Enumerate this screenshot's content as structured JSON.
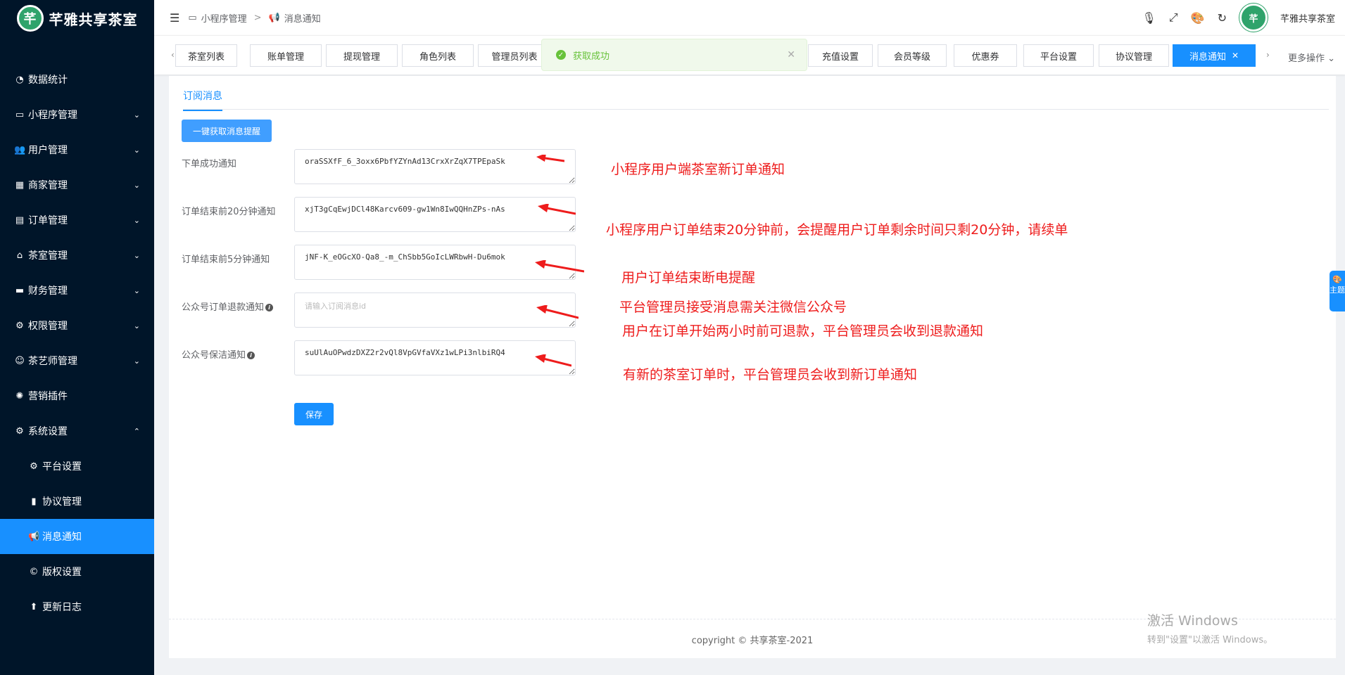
{
  "app": {
    "logo_text": "芊雅共享茶室",
    "logo_mark": "芊"
  },
  "sidebar": {
    "items": [
      {
        "label": "数据统计",
        "icon": "dashboard-icon",
        "glyph": "◔",
        "arrow": ""
      },
      {
        "label": "小程序管理",
        "icon": "laptop-icon",
        "glyph": "▭",
        "arrow": "⌄"
      },
      {
        "label": "用户管理",
        "icon": "users-icon",
        "glyph": "👥",
        "arrow": "⌄"
      },
      {
        "label": "商家管理",
        "icon": "store-icon",
        "glyph": "▦",
        "arrow": "⌄"
      },
      {
        "label": "订单管理",
        "icon": "clipboard-icon",
        "glyph": "▤",
        "arrow": "⌄"
      },
      {
        "label": "茶室管理",
        "icon": "home-icon",
        "glyph": "⌂",
        "arrow": "⌄"
      },
      {
        "label": "财务管理",
        "icon": "finance-icon",
        "glyph": "▬",
        "arrow": "⌄"
      },
      {
        "label": "权限管理",
        "icon": "permission-icon",
        "glyph": "⚙",
        "arrow": "⌄"
      },
      {
        "label": "茶艺师管理",
        "icon": "user-cog-icon",
        "glyph": "☺",
        "arrow": "⌄"
      },
      {
        "label": "营销插件",
        "icon": "plugin-icon",
        "glyph": "✺",
        "arrow": ""
      },
      {
        "label": "系统设置",
        "icon": "gear-icon",
        "glyph": "⚙",
        "arrow": "⌃"
      }
    ],
    "sub_items": [
      {
        "label": "平台设置",
        "icon": "gear-icon",
        "glyph": "⚙"
      },
      {
        "label": "协议管理",
        "icon": "book-icon",
        "glyph": "▮"
      },
      {
        "label": "消息通知",
        "icon": "megaphone-icon",
        "glyph": "📢"
      },
      {
        "label": "版权设置",
        "icon": "copyright-icon",
        "glyph": "©"
      },
      {
        "label": "更新日志",
        "icon": "upload-icon",
        "glyph": "⬆"
      }
    ]
  },
  "header": {
    "breadcrumb": [
      "小程序管理",
      "消息通知"
    ],
    "username": "芊雅共享茶室",
    "avatar_mark": "芊"
  },
  "tabs": [
    {
      "label": "茶室列表"
    },
    {
      "label": "账单管理"
    },
    {
      "label": "提现管理"
    },
    {
      "label": "角色列表"
    },
    {
      "label": "管理员列表"
    },
    {
      "label": "充值设置"
    },
    {
      "label": "会员等级"
    },
    {
      "label": "优惠券"
    },
    {
      "label": "平台设置"
    },
    {
      "label": "协议管理"
    },
    {
      "label": "消息通知"
    }
  ],
  "more_ops": "更多操作",
  "toast": {
    "text": "获取成功"
  },
  "page": {
    "sub_tab": "订阅消息",
    "fetch_button": "一键获取消息提醒",
    "save_button": "保存",
    "fields": [
      {
        "label": "下单成功通知",
        "value": "oraSSXfF_6_3oxx6PbfYZYnAd13CrxXrZqX7TPEpaSk",
        "placeholder": "",
        "info": false
      },
      {
        "label": "订单结束前20分钟通知",
        "value": "xjT3gCqEwjDCl48Karcv609-gw1Wn8IwQQHnZPs-nAs",
        "placeholder": "",
        "info": false
      },
      {
        "label": "订单结束前5分钟通知",
        "value": "jNF-K_eOGcXO-Qa8_-m_ChSbb5GoIcLWRbwH-Du6mok",
        "placeholder": "",
        "info": false
      },
      {
        "label": "公众号订单退款通知",
        "value": "",
        "placeholder": "请输入订阅消息id",
        "info": true
      },
      {
        "label": "公众号保洁通知",
        "value": "suUlAuOPwdzDXZ2r2vQl8VpGVfaVXz1wLPi3nlbiRQ4",
        "placeholder": "",
        "info": true
      }
    ],
    "annotations": [
      "小程序用户端茶室新订单通知",
      "小程序用户订单结束20分钟前，会提醒用户订单剩余时间只剩20分钟，请续单",
      "用户订单结束断电提醒",
      "平台管理员接受消息需关注微信公众号",
      "用户在订单开始两小时前可退款，平台管理员会收到退款通知",
      "有新的茶室订单时，平台管理员会收到新订单通知"
    ],
    "copyright": "copyright © 共享茶室-2021"
  },
  "windows_watermark": {
    "title": "激活 Windows",
    "subtitle": "转到\"设置\"以激活 Windows。"
  },
  "theme_tab": "主题",
  "colors": {
    "sidebar_bg": "#001529",
    "primary": "#1890ff",
    "annotation": "#ee1c1c",
    "success": "#67c23a"
  }
}
